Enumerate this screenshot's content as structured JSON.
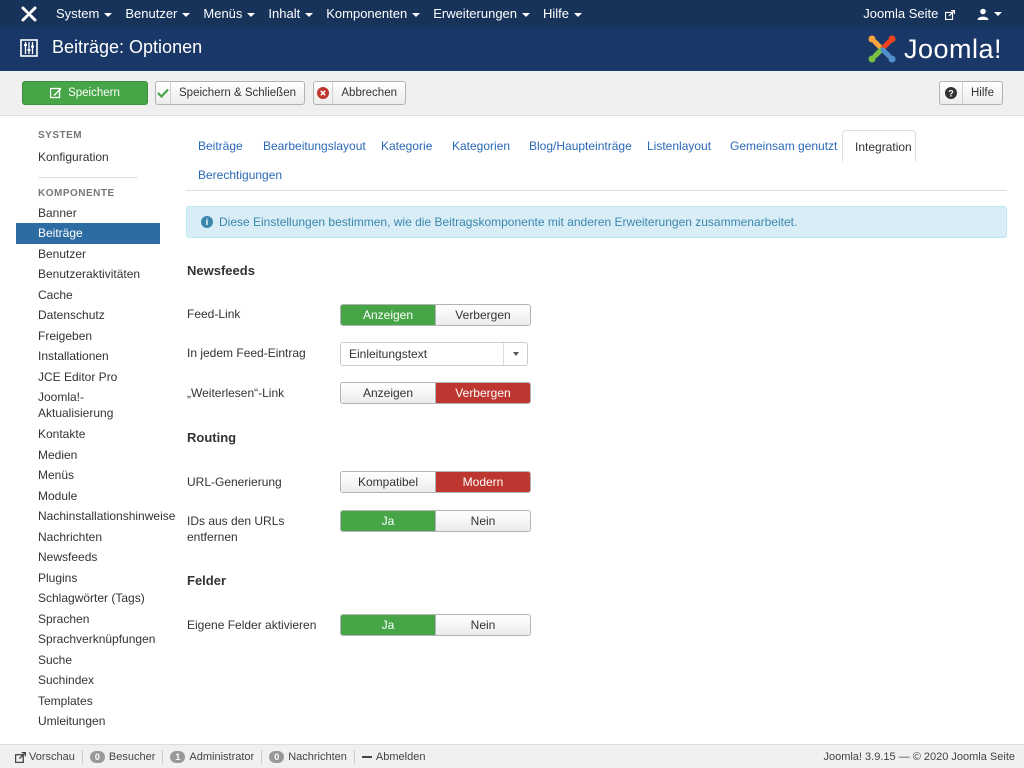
{
  "topnav": {
    "items": [
      "System",
      "Benutzer",
      "Menüs",
      "Inhalt",
      "Komponenten",
      "Erweiterungen",
      "Hilfe"
    ],
    "site_link": "Joomla Seite"
  },
  "header": {
    "title": "Beiträge: Optionen",
    "logo_text": "Joomla!"
  },
  "toolbar": {
    "save": "Speichern",
    "save_close": "Speichern & Schließen",
    "cancel": "Abbrechen",
    "help": "Hilfe"
  },
  "sidebar": {
    "system_heading": "SYSTEM",
    "system_items": [
      "Konfiguration"
    ],
    "components_heading": "KOMPONENTE",
    "items": [
      "Banner",
      "Beiträge",
      "Benutzer",
      "Benutzeraktivitäten",
      "Cache",
      "Datenschutz",
      "Freigeben",
      "Installationen",
      "JCE Editor Pro",
      "Joomla!-Aktualisierung",
      "Kontakte",
      "Medien",
      "Menüs",
      "Module",
      "Nachinstallationshinweise",
      "Nachrichten",
      "Newsfeeds",
      "Plugins",
      "Schlagwörter (Tags)",
      "Sprachen",
      "Sprachverknüpfungen",
      "Suche",
      "Suchindex",
      "Templates",
      "Umleitungen"
    ],
    "active": "Beiträge"
  },
  "tabs": [
    "Beiträge",
    "Bearbeitungslayout",
    "Kategorie",
    "Kategorien",
    "Blog/Haupteinträge",
    "Listenlayout",
    "Gemeinsam genutzt",
    "Integration",
    "Berechtigungen"
  ],
  "active_tab": "Integration",
  "alert": {
    "text": "Diese Einstellungen bestimmen, wie die Beitragskomponente mit anderen Erweiterungen zusammenarbeitet."
  },
  "form": {
    "newsfeeds": {
      "heading": "Newsfeeds",
      "feed_link": {
        "label": "Feed-Link",
        "options": [
          "Anzeigen",
          "Verbergen"
        ],
        "selected": "Anzeigen"
      },
      "feed_entry": {
        "label": "In jedem Feed-Eintrag",
        "value": "Einleitungstext"
      },
      "read_more": {
        "label": "„Weiterlesen“-Link",
        "options": [
          "Anzeigen",
          "Verbergen"
        ],
        "selected": "Verbergen"
      }
    },
    "routing": {
      "heading": "Routing",
      "url_gen": {
        "label": "URL-Generierung",
        "options": [
          "Kompatibel",
          "Modern"
        ],
        "selected": "Modern"
      },
      "remove_ids": {
        "label": "IDs aus den URLs entfernen",
        "options": [
          "Ja",
          "Nein"
        ],
        "selected": "Ja"
      }
    },
    "fields": {
      "heading": "Felder",
      "custom_fields": {
        "label": "Eigene Felder aktivieren",
        "options": [
          "Ja",
          "Nein"
        ],
        "selected": "Ja"
      }
    }
  },
  "statusbar": {
    "preview": "Vorschau",
    "visitors_count": "0",
    "visitors": "Besucher",
    "admins_count": "1",
    "admins": "Administrator",
    "messages_count": "0",
    "messages": "Nachrichten",
    "logout": "Abmelden",
    "version": "Joomla! 3.9.15 — © 2020 Joomla Seite"
  },
  "colors": {
    "nav": "#17335a",
    "header": "#1a3867",
    "active": "#2d6ca2",
    "green": "#46a546",
    "red": "#bd362f",
    "link": "#2a69b8"
  }
}
